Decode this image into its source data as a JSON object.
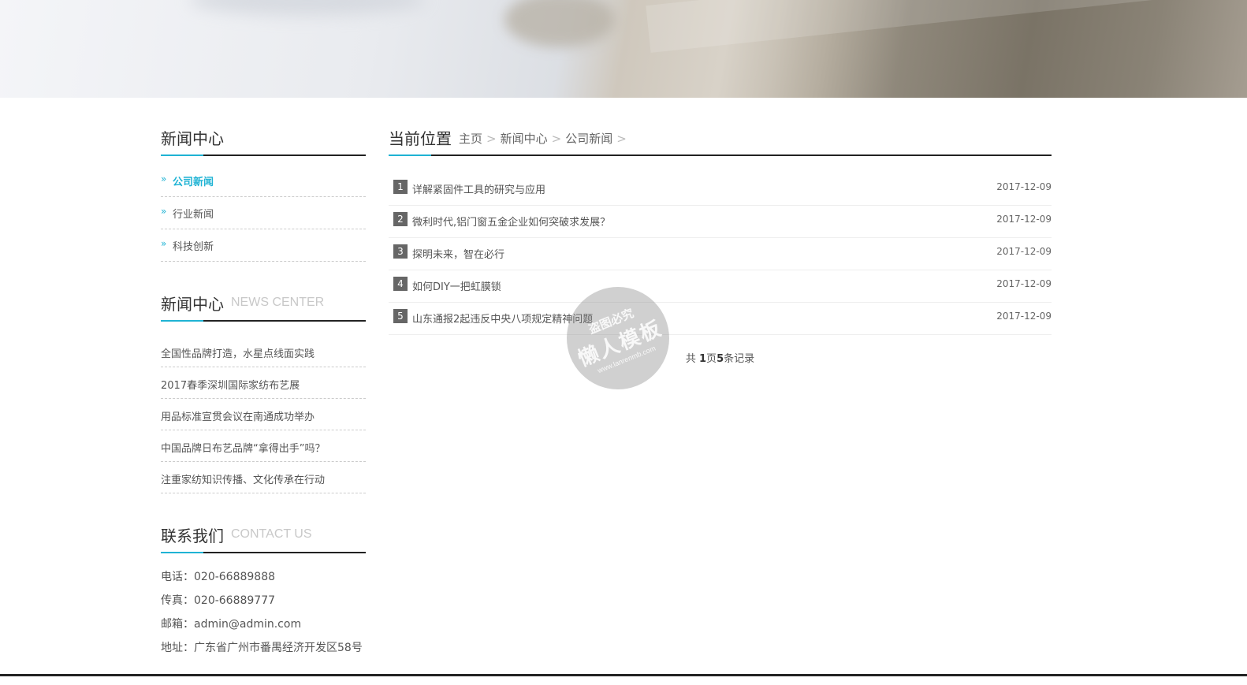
{
  "sidebar": {
    "categories_title": "新闻中心",
    "categories": [
      {
        "label": "公司新闻",
        "active": true
      },
      {
        "label": "行业新闻",
        "active": false
      },
      {
        "label": "科技创新",
        "active": false
      }
    ],
    "news_title_zh": "新闻中心",
    "news_title_en": "NEWS CENTER",
    "news": [
      "全国性品牌打造，水星点线面实践",
      "2017春季深圳国际家纺布艺展",
      "用品标准宣贯会议在南通成功举办",
      "中国品牌日布艺品牌“拿得出手”吗？",
      "注重家纺知识传播、文化传承在行动"
    ],
    "contact_title_zh": "联系我们",
    "contact_title_en": "CONTACT US",
    "contact": [
      "电话：020-66889888",
      "传真：020-66889777",
      "邮箱：admin@admin.com",
      "地址：广东省广州市番禺经济开发区58号"
    ]
  },
  "main": {
    "title": "当前位置",
    "breadcrumb": [
      "主页",
      "新闻中心",
      "公司新闻"
    ],
    "separator": ">",
    "articles": [
      {
        "num": "1",
        "title": "详解紧固件工具的研究与应用",
        "date": "2017-12-09"
      },
      {
        "num": "2",
        "title": "微利时代,铝门窗五金企业如何突破求发展？",
        "date": "2017-12-09"
      },
      {
        "num": "3",
        "title": "探明未来，智在必行",
        "date": "2017-12-09"
      },
      {
        "num": "4",
        "title": "如何DIY一把虹膜锁",
        "date": "2017-12-09"
      },
      {
        "num": "5",
        "title": "山东通报2起违反中央八项规定精神问题",
        "date": "2017-12-09"
      }
    ],
    "pager": {
      "prefix": "共 ",
      "pages": "1",
      "pages_suffix": "页",
      "records": "5",
      "records_suffix": "条记录"
    }
  },
  "watermark": {
    "line1": "盗图必究",
    "line2": "懒人模板",
    "line3": "www.lanrenmb.com"
  }
}
